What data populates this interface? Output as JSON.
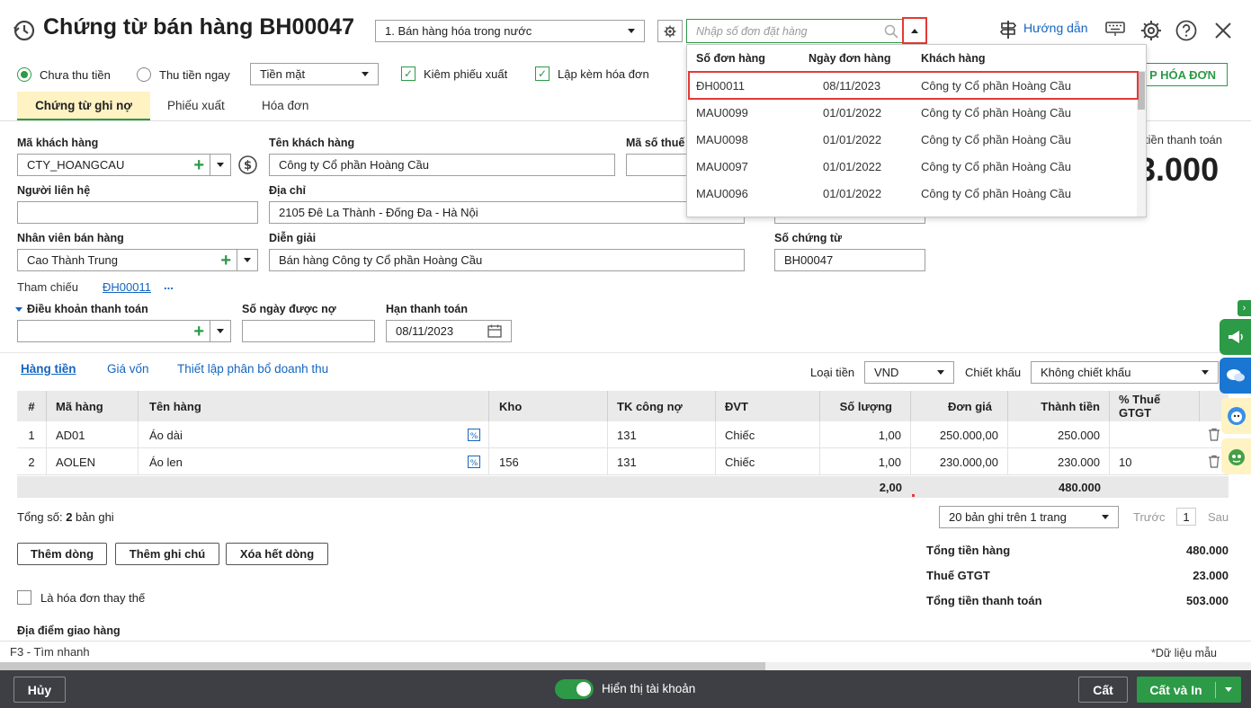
{
  "header": {
    "title": "Chứng từ bán hàng BH00047",
    "transaction_type": "1. Bán hàng hóa trong nước",
    "order_search_placeholder": "Nhập số đơn đặt hàng",
    "help_label": "Hướng dẫn",
    "create_invoice_label": "P HÓA ĐƠN"
  },
  "payment": {
    "unpaid_label": "Chưa thu tiền",
    "paid_now_label": "Thu tiền ngay",
    "method_value": "Tiền mặt",
    "check_export_label": "Kiêm phiếu xuất",
    "with_invoice_label": "Lập kèm hóa đơn"
  },
  "tabs": [
    "Chứng từ ghi nợ",
    "Phiếu xuất",
    "Hóa đơn"
  ],
  "form": {
    "customer_code_label": "Mã khách hàng",
    "customer_code_value": "CTY_HOANGCAU",
    "customer_name_label": "Tên khách hàng",
    "customer_name_value": "Công ty Cổ phần Hoàng Cầu",
    "tax_code_label": "Mã số thuế",
    "contact_label": "Người liên hệ",
    "address_label": "Địa chỉ",
    "address_value": "2105 Đê La Thành - Đống Đa - Hà Nội",
    "salesperson_label": "Nhân viên bán hàng",
    "salesperson_value": "Cao Thành Trung",
    "description_label": "Diễn giải",
    "description_value": "Bán hàng Công ty Cổ phần Hoàng Cầu",
    "voucher_no_label": "Số chứng từ",
    "voucher_no_value": "BH00047",
    "total_payment_label": "tiền thanh toán",
    "total_payment_value": "3.000",
    "reference_label": "Tham chiếu",
    "reference_value": "ĐH00011",
    "reference_more": "...",
    "payment_terms_label": "Điều khoản thanh toán",
    "credit_days_label": "Số ngày được nợ",
    "due_date_label": "Hạn thanh toán",
    "due_date_value": "08/11/2023"
  },
  "subtabs": [
    "Hàng tiền",
    "Giá vốn",
    "Thiết lập phân bổ doanh thu"
  ],
  "currency": {
    "label": "Loại tiền",
    "value": "VND"
  },
  "discount": {
    "label": "Chiết khấu",
    "value": "Không chiết khấu"
  },
  "grid": {
    "headers": [
      "#",
      "Mã hàng",
      "Tên hàng",
      "Kho",
      "TK công nợ",
      "ĐVT",
      "Số lượng",
      "Đơn giá",
      "Thành tiền",
      "% Thuế GTGT"
    ],
    "rows": [
      [
        "1",
        "AD01",
        "Áo dài",
        "",
        "131",
        "Chiếc",
        "1,00",
        "250.000,00",
        "250.000",
        ""
      ],
      [
        "2",
        "AOLEN",
        "Áo len",
        "156",
        "131",
        "Chiếc",
        "1,00",
        "230.000,00",
        "230.000",
        "10"
      ]
    ],
    "total_qty": "2,00",
    "total_amount": "480.000"
  },
  "paging": {
    "count_prefix": "Tổng số: ",
    "count_value": "2",
    "count_suffix": " bản ghi",
    "per_page": "20 bản ghi trên 1 trang",
    "prev": "Trước",
    "page": "1",
    "next": "Sau"
  },
  "actions": {
    "add_row": "Thêm dòng",
    "add_note": "Thêm ghi chú",
    "delete_rows": "Xóa hết dòng"
  },
  "replacement_invoice_label": "Là hóa đơn thay thế",
  "delivery_label": "Địa điểm giao hàng",
  "summary": [
    {
      "label": "Tổng tiền hàng",
      "value": "480.000"
    },
    {
      "label": "Thuế GTGT",
      "value": "23.000"
    },
    {
      "label": "Tổng tiền thanh toán",
      "value": "503.000"
    }
  ],
  "status": {
    "shortcut": "F3 - Tìm nhanh",
    "sample_data": "*Dữ liệu mẫu"
  },
  "footer": {
    "cancel": "Hủy",
    "show_account": "Hiển thị tài khoản",
    "save": "Cất",
    "save_print": "Cất và In"
  },
  "dropdown": {
    "headers": [
      "Số đơn hàng",
      "Ngày đơn hàng",
      "Khách hàng"
    ],
    "rows": [
      [
        "ĐH00011",
        "08/11/2023",
        "Công ty Cổ phần Hoàng Cầu"
      ],
      [
        "MAU0099",
        "01/01/2022",
        "Công ty Cổ phần Hoàng Cầu"
      ],
      [
        "MAU0098",
        "01/01/2022",
        "Công ty Cổ phần Hoàng Cầu"
      ],
      [
        "MAU0097",
        "01/01/2022",
        "Công ty Cổ phần Hoàng Cầu"
      ],
      [
        "MAU0096",
        "01/01/2022",
        "Công ty Cổ phần Hoàng Cầu"
      ]
    ]
  },
  "colors": {
    "accent": "#2c9a47",
    "link": "#1565c0",
    "highlight": "#e53935",
    "footer_bg": "#3d3f44"
  }
}
